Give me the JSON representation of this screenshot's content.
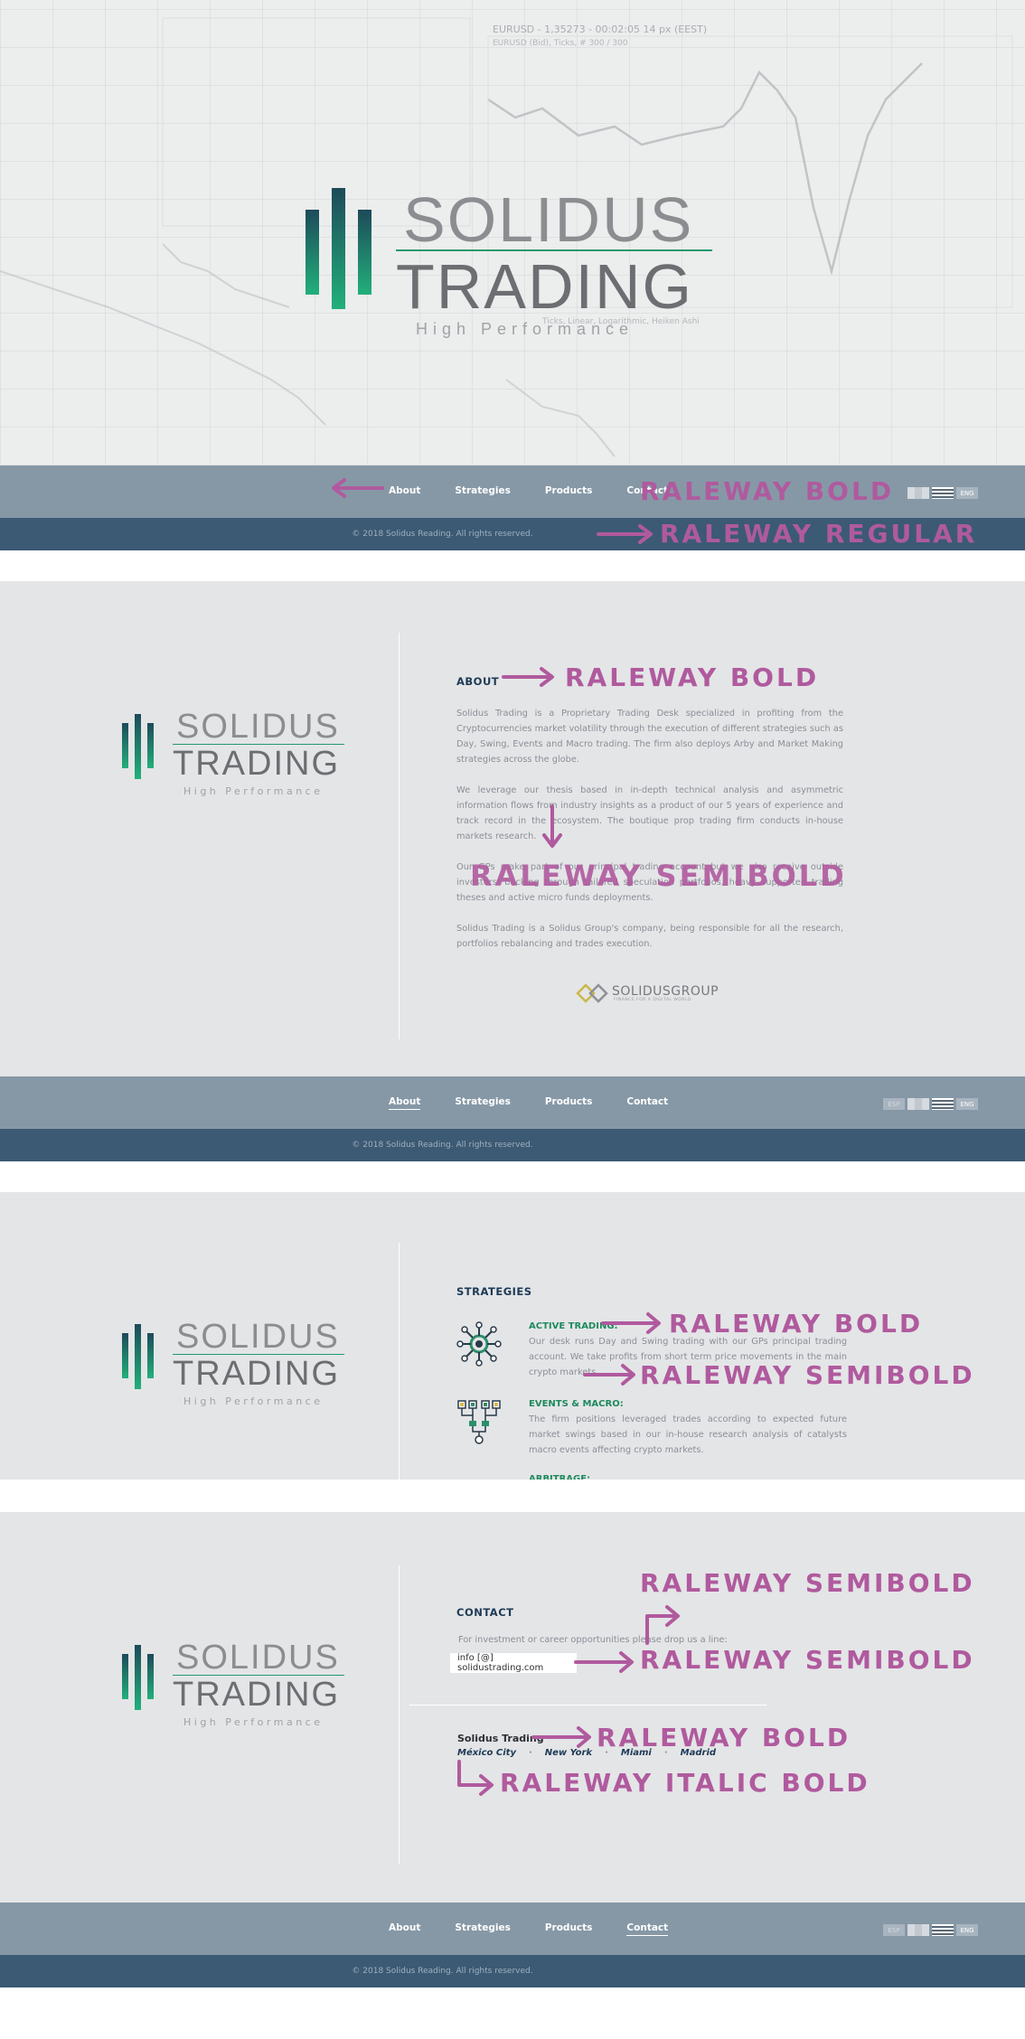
{
  "brand": {
    "word1": "SOLIDUS",
    "word2": "TRADING",
    "tagline": "High Performance"
  },
  "hero_chart_text": {
    "title": "EURUSD - 1,35273 - 00:02:05  14 px (EEST)",
    "subtitle": "EURUSD (Bid), Ticks, # 300 / 300",
    "bottom_text": "Ticks, Linear, Logarithmic, Heiken Ashi"
  },
  "nav": {
    "items": [
      "About",
      "Strategies",
      "Products",
      "Contact"
    ],
    "lang_esp": "ESP",
    "lang_eng": "ENG"
  },
  "footer": {
    "copyright": "© 2018 Solidus Reading. All rights reserved."
  },
  "annotations": {
    "nav_font": "RALEWAY BOLD",
    "footer_font": "RALEWAY REGULAR",
    "about_title_font": "RALEWAY BOLD",
    "about_body_font": "RALEWAY SEMIBOLD",
    "strat_title_font": "RALEWAY BOLD",
    "strat_body_font": "RALEWAY SEMIBOLD",
    "contact_top_font": "RALEWAY SEMIBOLD",
    "contact_email_font": "RALEWAY SEMIBOLD",
    "contact_company_font": "RALEWAY BOLD",
    "contact_cities_font": "RALEWAY ITALIC BOLD"
  },
  "about": {
    "title": "ABOUT",
    "paragraphs": [
      "Solidus Trading is a Proprietary Trading Desk specialized in profiting from the Cryptocurrencies market volatility through the execution of different strategies such as Day, Swing, Events and Macro trading. The firm also deploys Arby and Market Making strategies across the globe.",
      "We leverage our thesis based in in-depth technical analysis and asymmetric information flows from industry insights as a product of our 5 years of experience and track record in the ecosystem. The boutique prop trading firm conducts in-house markets research.",
      "Our GPs make part of our principal trading account but we also receive outside investors' backing through tailored speculation portfolios, heavy supported trading theses and active micro funds deployments.",
      "Solidus Trading is a Solidus Group's company, being responsible for all the research, portfolios rebalancing and trades execution."
    ],
    "group_logo_text": "SOLIDUSGROUP",
    "group_logo_sub": "FINANCE FOR A DIGITAL WORLD"
  },
  "strategies": {
    "title": "STRATEGIES",
    "items": [
      {
        "title": "ACTIVE TRADING:",
        "text": "Our desk runs Day and Swing trading with our GPs principal trading account. We take profits from short term price movements in the main crypto markets.",
        "icon": "network-nodes-icon"
      },
      {
        "title": "EVENTS & MACRO:",
        "text": "The firm positions leveraged trades according to expected future market swings based in our in-house research analysis of catalysts macro events affecting crypto markets.",
        "icon": "hierarchy-tree-icon"
      },
      {
        "title": "ARBITRAGE:",
        "text": "",
        "icon": ""
      }
    ]
  },
  "contact": {
    "title": "CONTACT",
    "intro": "For investment or career opportunities please drop us a line:",
    "email": "info [@] solidustrading.com",
    "company": "Solidus Trading",
    "cities": [
      "México City",
      "New York",
      "Miami",
      "Madrid"
    ],
    "separator": "·"
  },
  "colors": {
    "nav_bg": "#8698a6",
    "footer_bg": "#3c5a74",
    "panel_bg": "#e4e5e7",
    "title_navy": "#1d3a55",
    "accent_green": "#1f8a5e",
    "annotation": "#b05a9e"
  }
}
